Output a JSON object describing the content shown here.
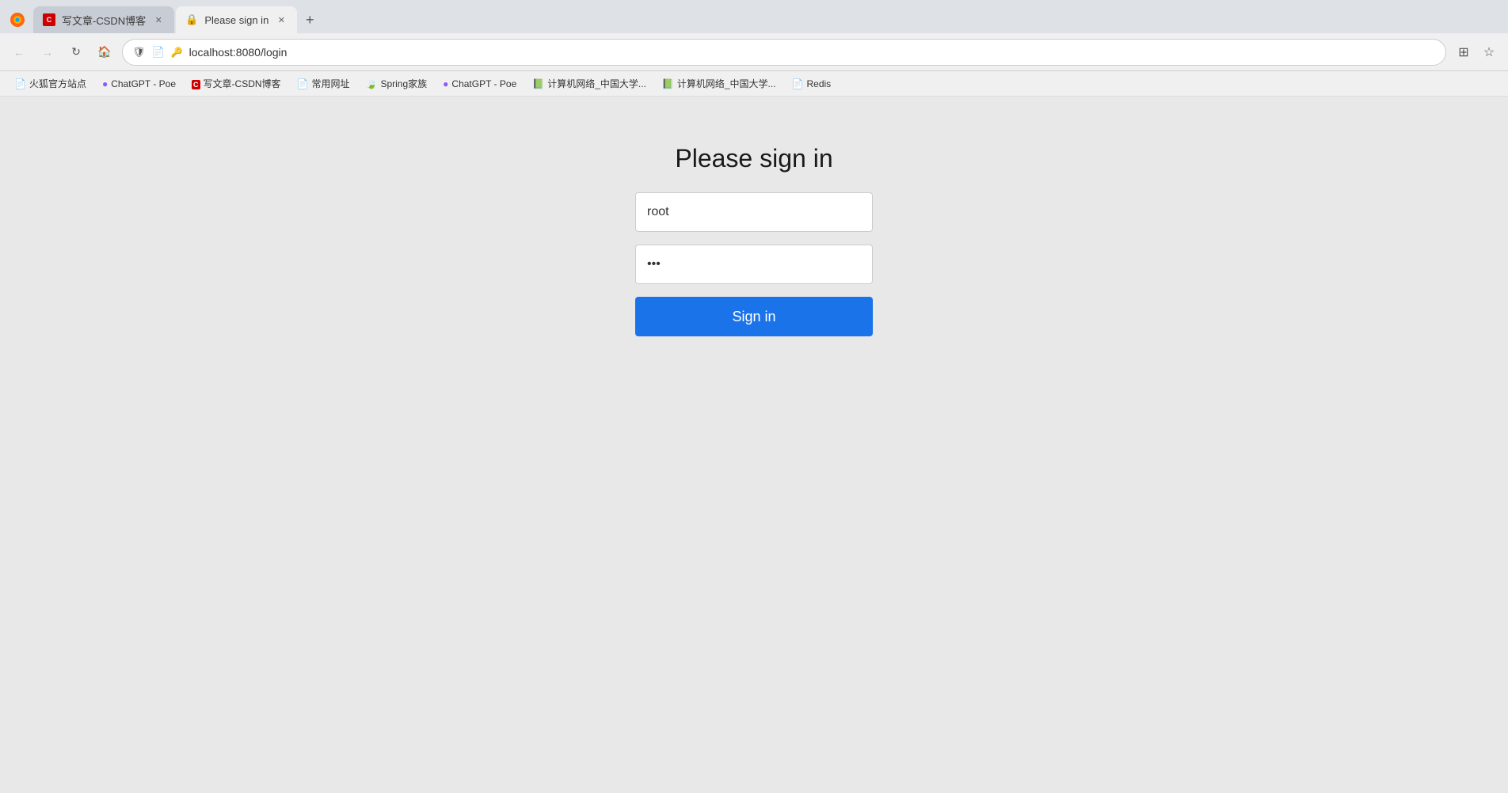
{
  "browser": {
    "tabs": [
      {
        "id": "tab-csdn",
        "title": "写文章-CSDN博客",
        "favicon": "csdn",
        "active": false
      },
      {
        "id": "tab-login",
        "title": "Please sign in",
        "favicon": "page",
        "active": true
      }
    ],
    "new_tab_label": "+",
    "url": "localhost:8080/login",
    "nav": {
      "back": "←",
      "forward": "→",
      "refresh": "↻",
      "home": "⌂"
    }
  },
  "bookmarks": [
    {
      "id": "bm-huhu",
      "label": "火狐官方站点",
      "icon": "📄"
    },
    {
      "id": "bm-chatgpt1",
      "label": "ChatGPT - Poe",
      "icon": "🟣"
    },
    {
      "id": "bm-csdn",
      "label": "写文章-CSDN博客",
      "icon": "C"
    },
    {
      "id": "bm-changyong",
      "label": "常用网址",
      "icon": "📄"
    },
    {
      "id": "bm-spring",
      "label": "Spring家族",
      "icon": "🍃"
    },
    {
      "id": "bm-chatgpt2",
      "label": "ChatGPT - Poe",
      "icon": "🟣"
    },
    {
      "id": "bm-jisuanji1",
      "label": "计算机网络_中国大学...",
      "icon": "📗"
    },
    {
      "id": "bm-jisuanji2",
      "label": "计算机网络_中国大学...",
      "icon": "📗"
    },
    {
      "id": "bm-redis",
      "label": "Redis",
      "icon": "📄"
    }
  ],
  "page": {
    "title": "Please sign in",
    "username_placeholder": "root",
    "username_value": "root",
    "password_value": "···",
    "sign_in_label": "Sign in"
  }
}
